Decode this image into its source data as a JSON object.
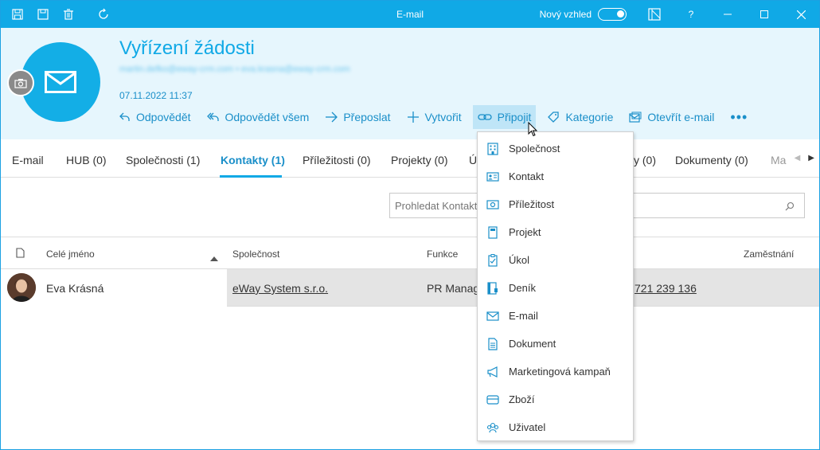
{
  "window": {
    "title": "E-mail",
    "new_look_label": "Nový vzhled",
    "help_label": "?"
  },
  "record": {
    "title": "Vyřízení žádosti",
    "emails": "martin.defko@eway-crm.com • eva.krasna@eway-crm.com",
    "date": "07.11.2022 11:37"
  },
  "actions": [
    {
      "label": "Odpovědět",
      "icon": "reply-icon"
    },
    {
      "label": "Odpovědět všem",
      "icon": "reply-all-icon"
    },
    {
      "label": "Přeposlat",
      "icon": "forward-icon"
    },
    {
      "label": "Vytvořit",
      "icon": "plus-icon"
    },
    {
      "label": "Připojit",
      "icon": "link-icon"
    },
    {
      "label": "Kategorie",
      "icon": "tag-icon"
    },
    {
      "label": "Otevřít e-mail",
      "icon": "open-mail-icon"
    }
  ],
  "tabs": [
    {
      "label": "E-mail"
    },
    {
      "label": "HUB (0)"
    },
    {
      "label": "Společnosti (1)"
    },
    {
      "label": "Kontakty (1)"
    },
    {
      "label": "Příležitosti (0)"
    },
    {
      "label": "Projekty (0)"
    },
    {
      "label": "Ú"
    },
    {
      "label": "y (0)"
    },
    {
      "label": "Dokumenty (0)"
    },
    {
      "label": "Ma"
    }
  ],
  "search": {
    "placeholder": "Prohledat Kontakty"
  },
  "table": {
    "columns": [
      "Celé jméno",
      "Společnost",
      "Funkce",
      "Zaměstnání"
    ],
    "rows": [
      {
        "name": "Eva Krásná",
        "company": "eWay System s.r.o.",
        "function": "PR Manag",
        "phone": "721 239 136"
      }
    ]
  },
  "dropdown": {
    "items": [
      {
        "label": "Společnost",
        "icon": "company-icon"
      },
      {
        "label": "Kontakt",
        "icon": "contact-card-icon"
      },
      {
        "label": "Příležitost",
        "icon": "opportunity-icon"
      },
      {
        "label": "Projekt",
        "icon": "project-icon"
      },
      {
        "label": "Úkol",
        "icon": "task-icon"
      },
      {
        "label": "Deník",
        "icon": "journal-icon"
      },
      {
        "label": "E-mail",
        "icon": "email-icon"
      },
      {
        "label": "Dokument",
        "icon": "document-icon"
      },
      {
        "label": "Marketingová kampaň",
        "icon": "campaign-icon"
      },
      {
        "label": "Zboží",
        "icon": "goods-icon"
      },
      {
        "label": "Uživatel",
        "icon": "users-icon"
      }
    ]
  },
  "colors": {
    "accent": "#10a9e6",
    "link": "#1a8fc9",
    "header_bg": "#e6f6fd",
    "active_action_bg": "#bfe5f7"
  }
}
